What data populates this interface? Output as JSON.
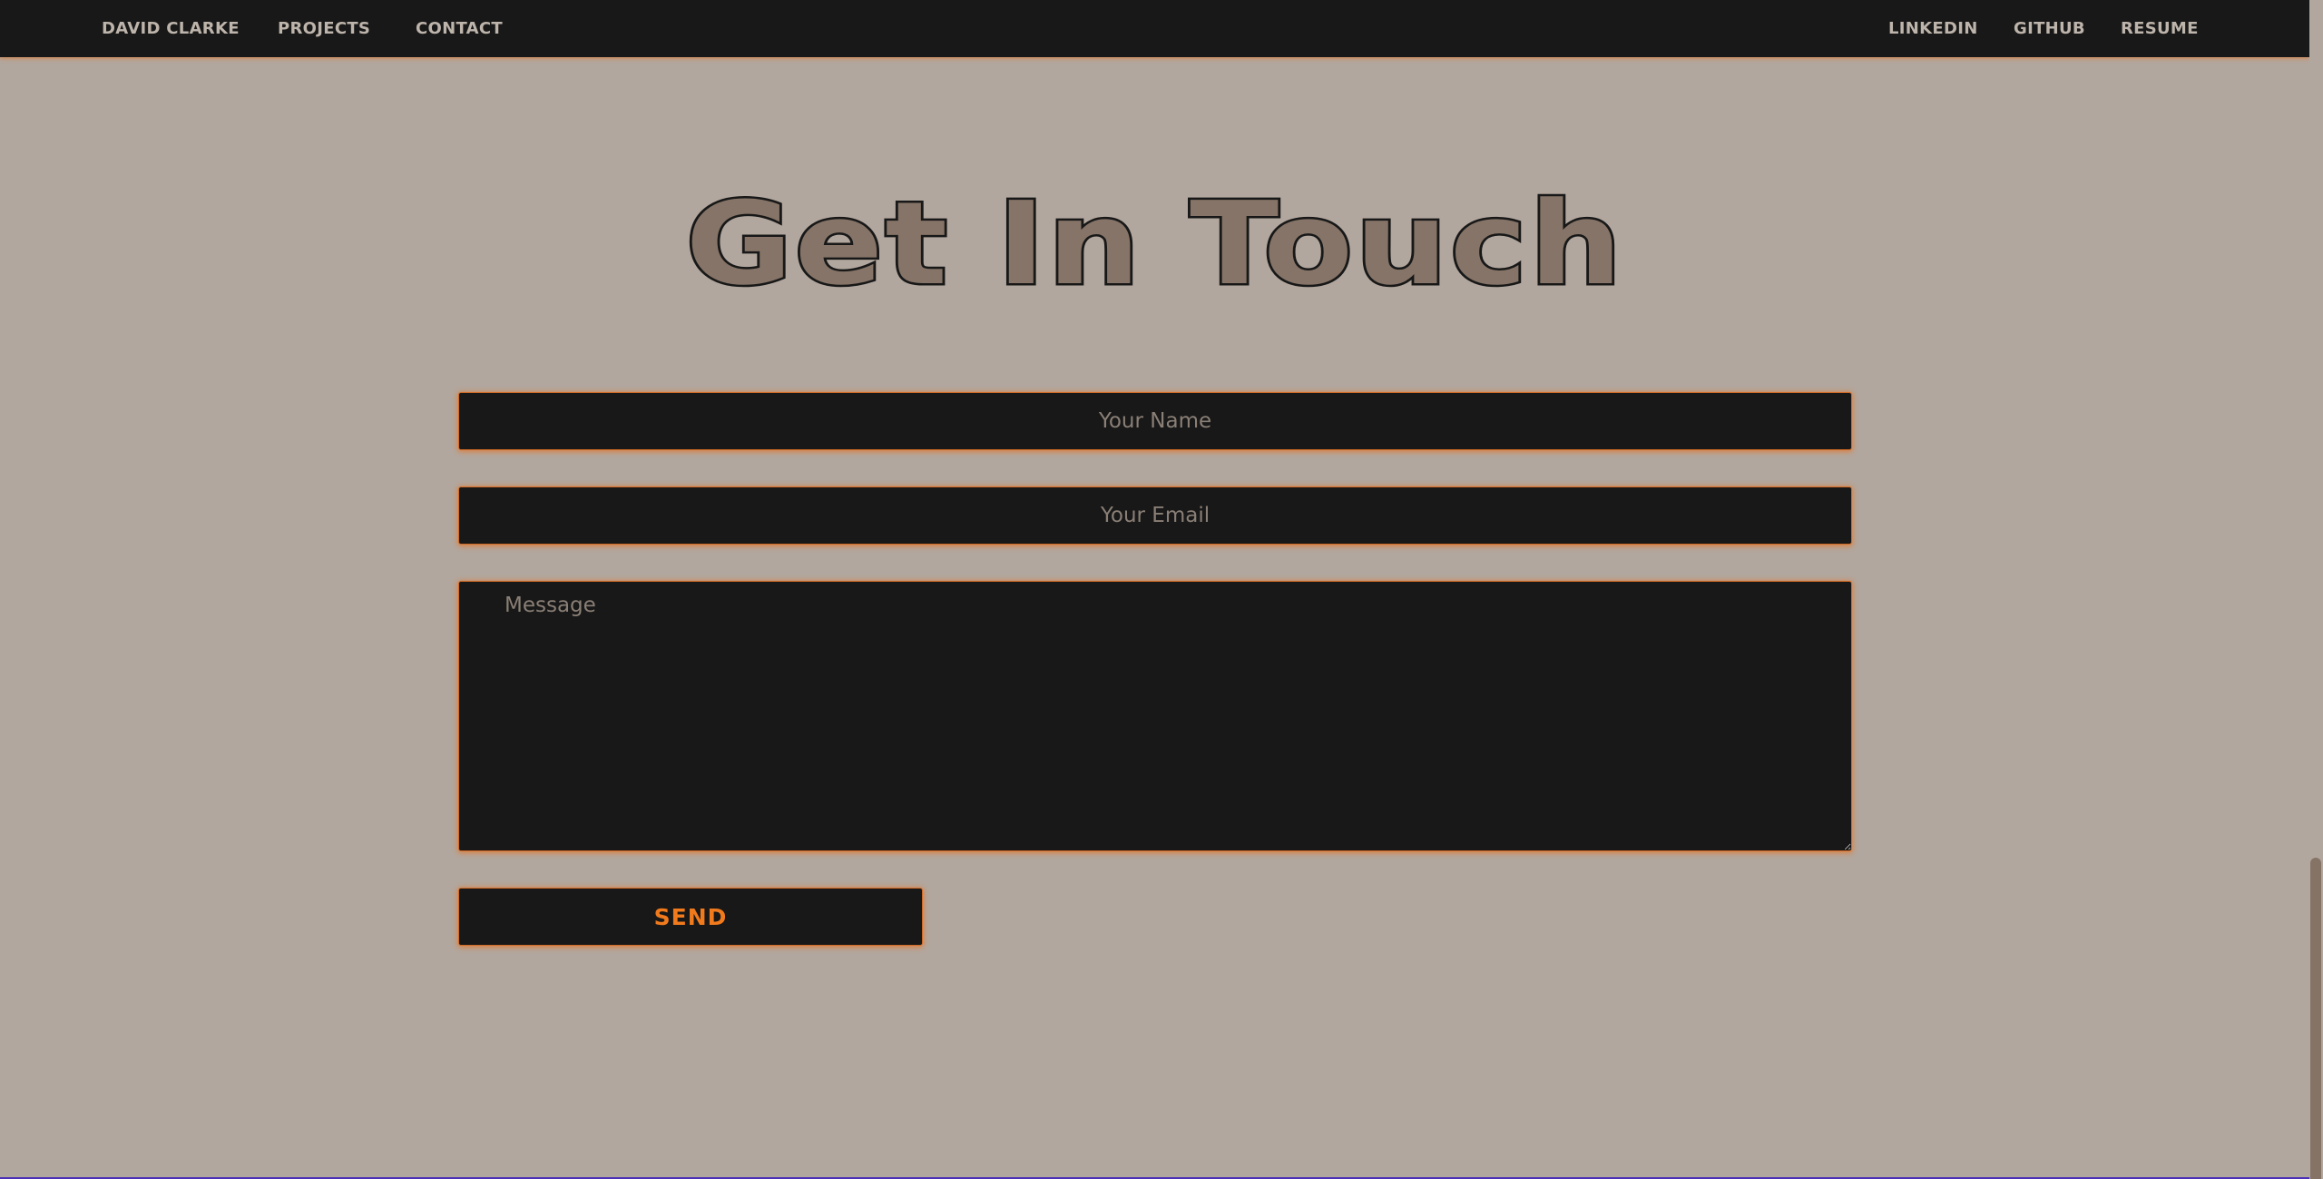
{
  "nav": {
    "brand": "DAVID CLARKE",
    "left_links": [
      "PROJECTS",
      "CONTACT"
    ],
    "right_links": [
      "LINKEDIN",
      "GITHUB",
      "RESUME"
    ]
  },
  "contact": {
    "heading": "Get In Touch",
    "name_placeholder": "Your Name",
    "email_placeholder": "Your Email",
    "message_placeholder": "Message",
    "send_label": "SEND"
  },
  "colors": {
    "page_background": "#b2a79e",
    "navbar_background": "#181818",
    "nav_text": "#bdb4ab",
    "heading_fill": "#857467",
    "heading_stroke": "#181818",
    "field_background": "#181818",
    "accent_glow": "#e87424",
    "send_text": "#f07a1c",
    "placeholder_text": "#8a7f76"
  }
}
